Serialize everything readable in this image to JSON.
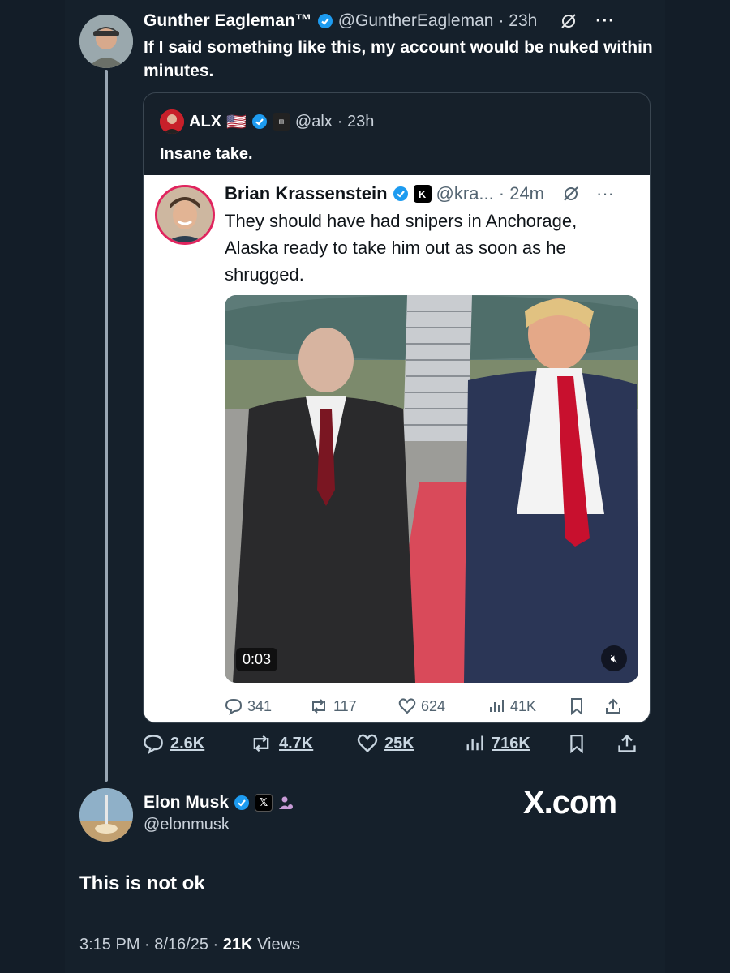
{
  "top_tweet": {
    "author_name": "Gunther Eagleman™",
    "handle": "@GuntherEagleman",
    "time": "· 23h",
    "more": "···",
    "text": "If I said something like this, my account would be nuked within minutes."
  },
  "quoted_tweet": {
    "author_name": "ALX",
    "flag": "🇺🇸",
    "handle": "@alx",
    "time": "· 23h",
    "text": "Insane take."
  },
  "nested_tweet": {
    "author_name": "Brian Krassenstein",
    "handle": "@kra...",
    "time": "· 24m",
    "more": "···",
    "text": "They should have had snipers in Anchorage, Alaska ready to take him out as soon as he shrugged.",
    "video_time": "0:03",
    "stats": {
      "replies": "341",
      "reposts": "117",
      "likes": "624",
      "views": "41K"
    }
  },
  "thread_stats": {
    "replies": "2.6K",
    "reposts": "4.7K",
    "likes": "25K",
    "views": "716K"
  },
  "reply": {
    "author_name": "Elon Musk",
    "handle": "@elonmusk",
    "x_badge": "𝕏",
    "text": "This is not ok",
    "timestamp": "3:15 PM · 8/16/25 · ",
    "views_count": "21K",
    "views_label": " Views"
  },
  "watermark": "X.com",
  "colors": {
    "background": "#15202b",
    "verified": "#1d9bf0",
    "tie": "#c8102e",
    "carpet": "#d94a5a"
  }
}
